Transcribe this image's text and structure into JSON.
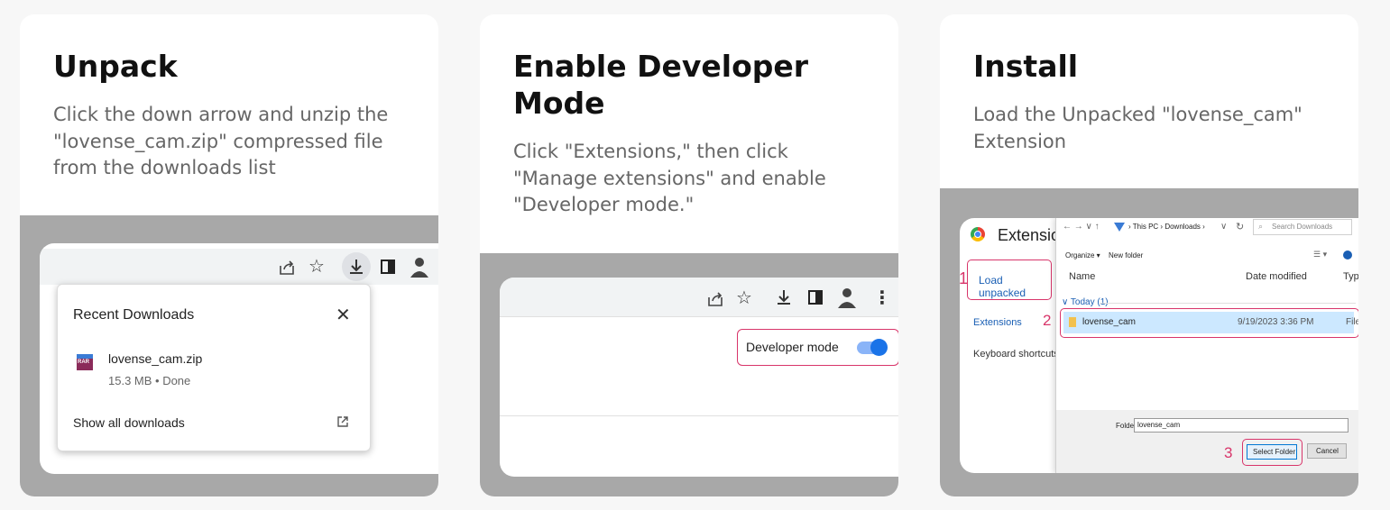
{
  "cards": [
    {
      "title": "Unpack",
      "description": "Click the down arrow and unzip the \"lovense_cam.zip\" compressed file from the downloads list",
      "screenshot": {
        "popup_title": "Recent Downloads",
        "file_name": "lovense_cam.zip",
        "file_meta": "15.3 MB • Done",
        "show_all": "Show all downloads",
        "file_icon_text": "RAR"
      }
    },
    {
      "title": "Enable Developer Mode",
      "description": "Click \"Extensions,\" then click \"Manage extensions\" and enable \"Developer mode.\"",
      "screenshot": {
        "dev_mode_label": "Developer mode",
        "toggle_on": true
      }
    },
    {
      "title": "Install",
      "description": "Load the Unpacked \"lovense_cam\" Extension",
      "screenshot": {
        "ext_title": "Extensions",
        "load_unpacked": "Load unpacked",
        "side_extensions": "Extensions",
        "side_shortcuts": "Keyboard shortcuts",
        "path": [
          "This PC",
          "Downloads"
        ],
        "search_placeholder": "Search Downloads",
        "organize": "Organize ▾",
        "new_folder": "New folder",
        "col_name": "Name",
        "col_date": "Date modified",
        "col_type": "Typ",
        "group": "Today (1)",
        "row_name": "lovense_cam",
        "row_date": "9/19/2023 3:36 PM",
        "row_type": "File",
        "folder_label": "Folder:",
        "folder_value": "lovense_cam",
        "select_folder": "Select Folder",
        "cancel": "Cancel",
        "step1": "1",
        "step2": "2",
        "step3": "3"
      }
    }
  ],
  "colors": {
    "highlight": "#d8356a",
    "toggle": "#1a73e8",
    "row_selected": "#cce8ff"
  }
}
